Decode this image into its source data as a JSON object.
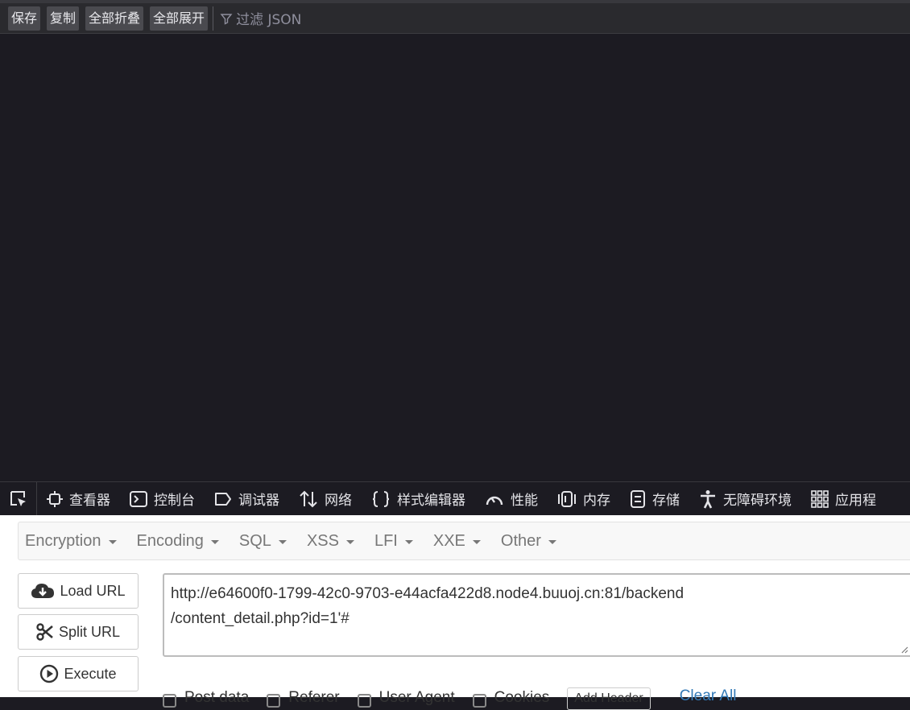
{
  "json_viewer": {
    "toolbar": {
      "save": "保存",
      "copy": "复制",
      "collapse_all": "全部折叠",
      "expand_all": "全部展开",
      "filter_placeholder": "过滤 JSON"
    }
  },
  "devtools": {
    "tabs": [
      {
        "label": "查看器",
        "icon": "inspector-icon"
      },
      {
        "label": "控制台",
        "icon": "console-icon"
      },
      {
        "label": "调试器",
        "icon": "debugger-icon"
      },
      {
        "label": "网络",
        "icon": "network-icon"
      },
      {
        "label": "样式编辑器",
        "icon": "style-editor-icon"
      },
      {
        "label": "性能",
        "icon": "performance-icon"
      },
      {
        "label": "内存",
        "icon": "memory-icon"
      },
      {
        "label": "存储",
        "icon": "storage-icon"
      },
      {
        "label": "无障碍环境",
        "icon": "accessibility-icon"
      },
      {
        "label": "应用程",
        "icon": "application-icon"
      }
    ]
  },
  "hackbar": {
    "menu": [
      "Encryption",
      "Encoding",
      "SQL",
      "XSS",
      "LFI",
      "XXE",
      "Other"
    ],
    "load_url": "Load URL",
    "split_url": "Split URL",
    "execute": "Execute",
    "url_value": "http://e64600f0-1799-42c0-9703-e44acfa422d8.node4.buuoj.cn:81/backend\n/content_detail.php?id=1'#",
    "options": [
      "Post data",
      "Referer",
      "User Agent",
      "Cookies"
    ],
    "add_header": "Add Header",
    "clear_all": "Clear All"
  }
}
